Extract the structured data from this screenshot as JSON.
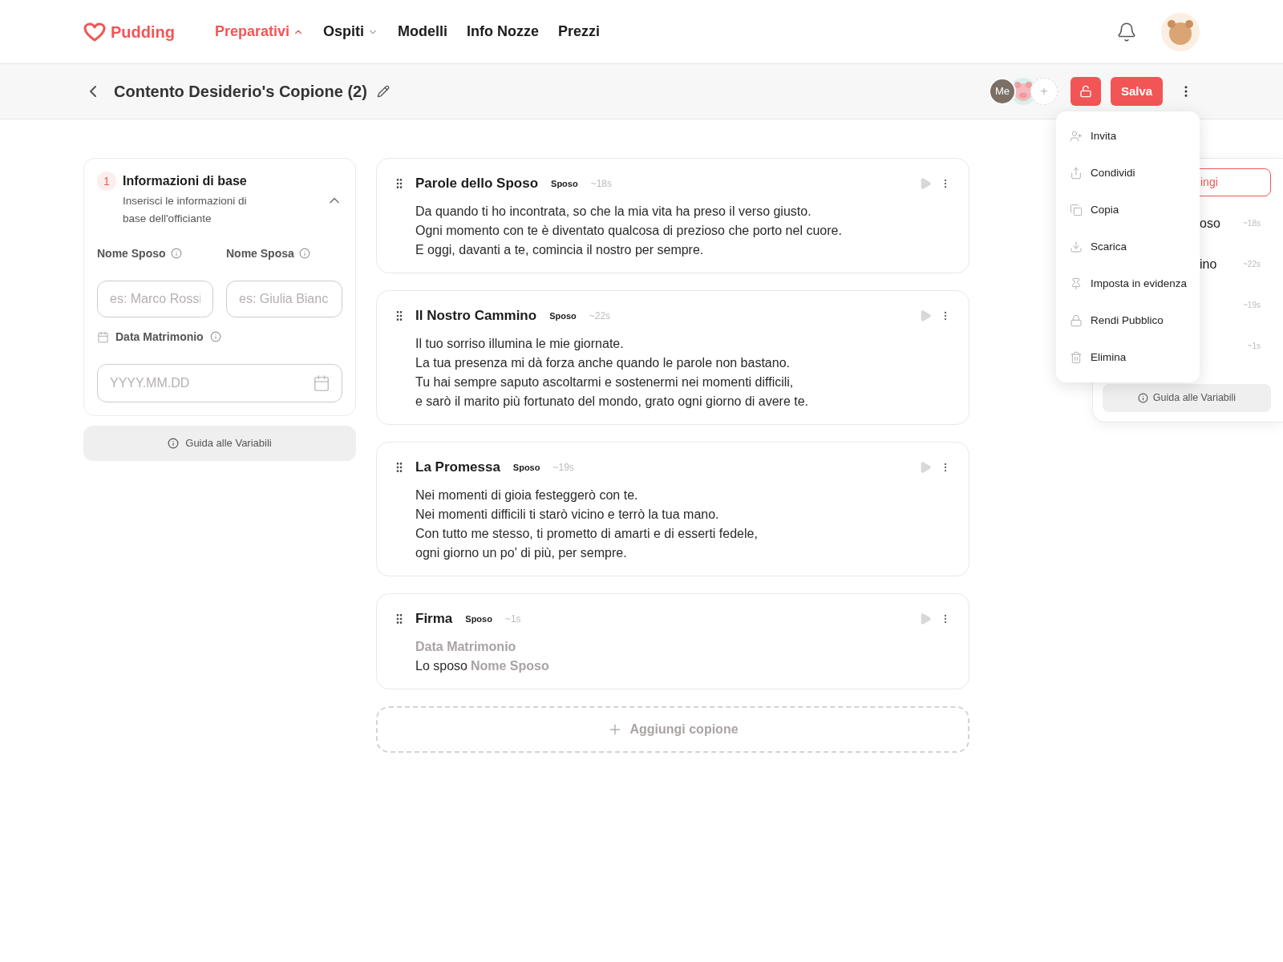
{
  "nav": {
    "logo": "Pudding",
    "items": [
      {
        "label": "Preparativi",
        "selected": true,
        "dropdown": true
      },
      {
        "label": "Ospiti",
        "selected": false,
        "dropdown": true
      },
      {
        "label": "Modelli",
        "selected": false,
        "dropdown": false
      },
      {
        "label": "Info Nozze",
        "selected": false,
        "dropdown": false
      },
      {
        "label": "Prezzi",
        "selected": false,
        "dropdown": false
      }
    ]
  },
  "toolbar": {
    "title": "Contento Desiderio's Copione (2)",
    "collaborators": [
      {
        "kind": "initials",
        "label": "Me"
      },
      {
        "kind": "picture"
      }
    ],
    "add": "+",
    "save": "Salva"
  },
  "menu": {
    "items": [
      {
        "label": "Invita"
      },
      {
        "label": "Condividi"
      },
      {
        "label": "Copia"
      },
      {
        "label": "Scarica"
      },
      {
        "label": "Imposta in evidenza"
      },
      {
        "label": "Rendi Pubblico"
      },
      {
        "label": "Elimina"
      }
    ]
  },
  "info_card": {
    "step": "1",
    "title": "Informazioni di base",
    "subtitle": "Inserisci le informazioni di base dell'officiante",
    "expanded": true,
    "fields": [
      {
        "label": "Nome Sposo",
        "placeholder": "es: Marco Rossi"
      },
      {
        "label": "Nome Sposa",
        "placeholder": "es: Giulia Bianc"
      }
    ],
    "date": {
      "label": "Data Matrimonio",
      "placeholder": "YYYY.MM.DD"
    }
  },
  "guide_button": "Guida alle Variabili",
  "scripts": [
    {
      "title": "Parole dello Sposo",
      "speaker": "Sposo",
      "duration": "~18s",
      "lines": [
        [
          {
            "kind": "text",
            "text": "Da quando ti ho incontrata, so che la mia vita ha preso il verso giusto."
          }
        ],
        [
          {
            "kind": "text",
            "text": "Ogni momento con te è diventato qualcosa di prezioso che porto nel cuore."
          }
        ],
        [
          {
            "kind": "text",
            "text": "E oggi, davanti a te, comincia il nostro per sempre."
          }
        ]
      ]
    },
    {
      "title": "Il Nostro Cammino",
      "speaker": "Sposo",
      "duration": "~22s",
      "lines": [
        [
          {
            "kind": "text",
            "text": "Il tuo sorriso illumina le mie giornate."
          }
        ],
        [
          {
            "kind": "text",
            "text": "La tua presenza mi dà forza anche quando le parole non bastano."
          }
        ],
        [
          {
            "kind": "text",
            "text": "Tu hai sempre saputo ascoltarmi e sostenermi nei momenti difficili,"
          }
        ],
        [
          {
            "kind": "text",
            "text": "e sarò il marito più fortunato del mondo, grato ogni giorno di avere te."
          }
        ]
      ]
    },
    {
      "title": "La Promessa",
      "speaker": "Sposo",
      "duration": "~19s",
      "lines": [
        [
          {
            "kind": "text",
            "text": "Nei momenti di gioia festeggerò con te."
          }
        ],
        [
          {
            "kind": "text",
            "text": "Nei momenti difficili ti starò vicino e terrò la tua mano."
          }
        ],
        [
          {
            "kind": "text",
            "text": "Con tutto me stesso, ti prometto di amarti e di esserti fedele,"
          }
        ],
        [
          {
            "kind": "text",
            "text": "ogni giorno un po' di più, per sempre."
          }
        ]
      ]
    },
    {
      "title": "Firma",
      "speaker": "Sposo",
      "duration": "~1s",
      "lines": [
        [
          {
            "kind": "variable",
            "text": "Data Matrimonio"
          }
        ],
        [
          {
            "kind": "text",
            "text": "Lo sposo"
          },
          {
            "kind": "variable",
            "text": "Nome Sposo"
          }
        ]
      ]
    }
  ],
  "add_script": "Aggiungi copione",
  "side_panel": {
    "button": "ingi",
    "items": [
      {
        "title": "oso",
        "duration": "~18s"
      },
      {
        "title": "ino",
        "duration": "~22s"
      },
      {
        "duration": "~19s"
      },
      {
        "duration": "~1s"
      }
    ],
    "guide": "Guida alle Variabili"
  }
}
